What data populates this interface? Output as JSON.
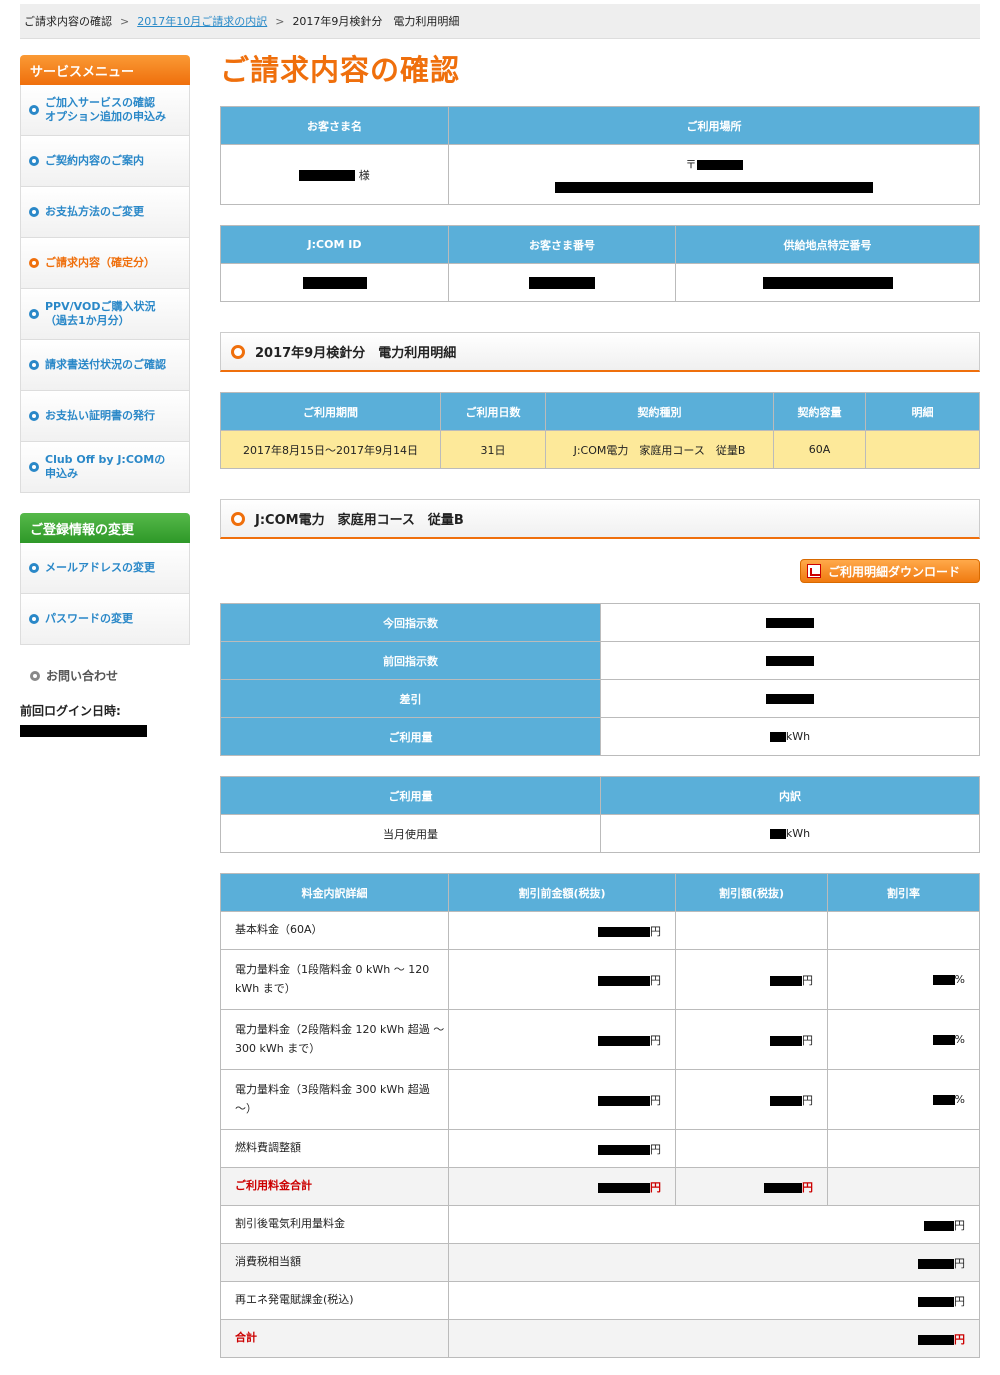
{
  "breadcrumb": {
    "home": "ご請求内容の確認",
    "sep1": ">",
    "link": "2017年10月ご請求の内訳",
    "sep2": ">",
    "current": "2017年9月検針分　電力利用明細"
  },
  "sidebar": {
    "service_header": "サービスメニュー",
    "items": [
      {
        "line1": "ご加入サービスの確認",
        "line2": "オプション追加の申込み"
      },
      {
        "line1": "ご契約内容のご案内",
        "line2": ""
      },
      {
        "line1": "お支払方法のご変更",
        "line2": ""
      },
      {
        "line1": "ご請求内容（確定分）",
        "line2": ""
      },
      {
        "line1": "PPV/VODご購入状況",
        "line2": "（過去1か月分）"
      },
      {
        "line1": "請求書送付状況のご確認",
        "line2": ""
      },
      {
        "line1": "お支払い証明書の発行",
        "line2": ""
      },
      {
        "line1": "Club Off by J:COMの",
        "line2": "申込み"
      }
    ],
    "reg_header": "ご登録情報の変更",
    "reg_items": [
      "メールアドレスの変更",
      "パスワードの変更"
    ],
    "inquiry": "お問い合わせ",
    "last_login_label": "前回ログイン日時:"
  },
  "page": {
    "title": "ご請求内容の確認"
  },
  "customer": {
    "name_header": "お客さま名",
    "place_header": "ご利用場所",
    "suffix": "様",
    "postal_mark": "〒"
  },
  "ids": {
    "h1": "J:COM ID",
    "h2": "お客さま番号",
    "h3": "供給地点特定番号"
  },
  "section1": {
    "title": "2017年9月検針分　電力利用明細"
  },
  "period": {
    "headers": [
      "ご利用期間",
      "ご利用日数",
      "契約種別",
      "契約容量",
      "明細"
    ],
    "row": [
      "2017年8月15日～2017年9月14日",
      "31日",
      "J:COM電力　家庭用コース　従量B",
      "60A",
      ""
    ]
  },
  "section2": {
    "title": "J:COM電力　家庭用コース　従量B"
  },
  "download": {
    "label": "ご利用明細ダウンロード"
  },
  "meter": {
    "rows": [
      "今回指示数",
      "前回指示数",
      "差引",
      "ご利用量"
    ],
    "unit": "kWh"
  },
  "usage": {
    "h1": "ご利用量",
    "h2": "内訳",
    "row_label": "当月使用量",
    "unit": "kWh"
  },
  "detail": {
    "headers": [
      "料金内訳詳細",
      "割引前金額(税抜)",
      "割引額(税抜)",
      "割引率"
    ],
    "yen": "円",
    "pct": "%",
    "rows": [
      {
        "label": "基本料金（60A）"
      },
      {
        "label": "電力量料金（1段階料金 0 kWh ～ 120 kWh まで）"
      },
      {
        "label": "電力量料金（2段階料金 120 kWh 超過 ～ 300 kWh まで）"
      },
      {
        "label": "電力量料金（3段階料金 300 kWh 超過 ～）"
      },
      {
        "label": "燃料費調整額"
      },
      {
        "label": "ご利用料金合計"
      },
      {
        "label": "割引後電気利用量料金"
      },
      {
        "label": "消費税相当額"
      },
      {
        "label": "再エネ発電賦課金(税込)"
      },
      {
        "label": "合計"
      }
    ]
  },
  "colors": {
    "accent": "#ef6f0c",
    "header_blue": "#5aafd9",
    "link": "#2a88c8",
    "highlight": "#fde99a",
    "total_red": "#cc0000"
  }
}
